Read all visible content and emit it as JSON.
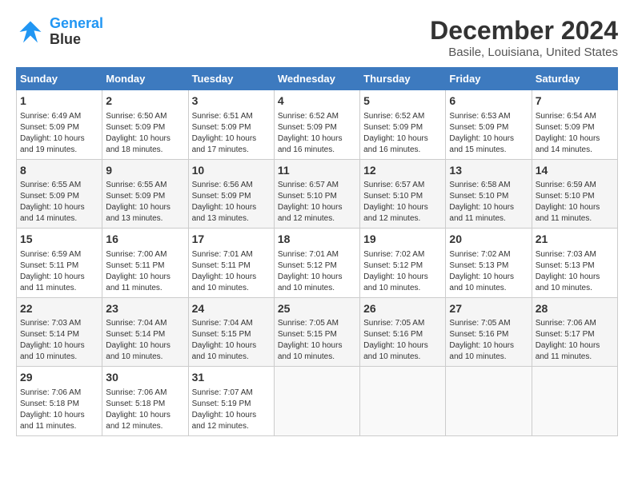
{
  "header": {
    "logo_line1": "General",
    "logo_line2": "Blue",
    "month": "December 2024",
    "location": "Basile, Louisiana, United States"
  },
  "weekdays": [
    "Sunday",
    "Monday",
    "Tuesday",
    "Wednesday",
    "Thursday",
    "Friday",
    "Saturday"
  ],
  "weeks": [
    [
      {
        "day": "1",
        "info": "Sunrise: 6:49 AM\nSunset: 5:09 PM\nDaylight: 10 hours\nand 19 minutes."
      },
      {
        "day": "2",
        "info": "Sunrise: 6:50 AM\nSunset: 5:09 PM\nDaylight: 10 hours\nand 18 minutes."
      },
      {
        "day": "3",
        "info": "Sunrise: 6:51 AM\nSunset: 5:09 PM\nDaylight: 10 hours\nand 17 minutes."
      },
      {
        "day": "4",
        "info": "Sunrise: 6:52 AM\nSunset: 5:09 PM\nDaylight: 10 hours\nand 16 minutes."
      },
      {
        "day": "5",
        "info": "Sunrise: 6:52 AM\nSunset: 5:09 PM\nDaylight: 10 hours\nand 16 minutes."
      },
      {
        "day": "6",
        "info": "Sunrise: 6:53 AM\nSunset: 5:09 PM\nDaylight: 10 hours\nand 15 minutes."
      },
      {
        "day": "7",
        "info": "Sunrise: 6:54 AM\nSunset: 5:09 PM\nDaylight: 10 hours\nand 14 minutes."
      }
    ],
    [
      {
        "day": "8",
        "info": "Sunrise: 6:55 AM\nSunset: 5:09 PM\nDaylight: 10 hours\nand 14 minutes."
      },
      {
        "day": "9",
        "info": "Sunrise: 6:55 AM\nSunset: 5:09 PM\nDaylight: 10 hours\nand 13 minutes."
      },
      {
        "day": "10",
        "info": "Sunrise: 6:56 AM\nSunset: 5:09 PM\nDaylight: 10 hours\nand 13 minutes."
      },
      {
        "day": "11",
        "info": "Sunrise: 6:57 AM\nSunset: 5:10 PM\nDaylight: 10 hours\nand 12 minutes."
      },
      {
        "day": "12",
        "info": "Sunrise: 6:57 AM\nSunset: 5:10 PM\nDaylight: 10 hours\nand 12 minutes."
      },
      {
        "day": "13",
        "info": "Sunrise: 6:58 AM\nSunset: 5:10 PM\nDaylight: 10 hours\nand 11 minutes."
      },
      {
        "day": "14",
        "info": "Sunrise: 6:59 AM\nSunset: 5:10 PM\nDaylight: 10 hours\nand 11 minutes."
      }
    ],
    [
      {
        "day": "15",
        "info": "Sunrise: 6:59 AM\nSunset: 5:11 PM\nDaylight: 10 hours\nand 11 minutes."
      },
      {
        "day": "16",
        "info": "Sunrise: 7:00 AM\nSunset: 5:11 PM\nDaylight: 10 hours\nand 11 minutes."
      },
      {
        "day": "17",
        "info": "Sunrise: 7:01 AM\nSunset: 5:11 PM\nDaylight: 10 hours\nand 10 minutes."
      },
      {
        "day": "18",
        "info": "Sunrise: 7:01 AM\nSunset: 5:12 PM\nDaylight: 10 hours\nand 10 minutes."
      },
      {
        "day": "19",
        "info": "Sunrise: 7:02 AM\nSunset: 5:12 PM\nDaylight: 10 hours\nand 10 minutes."
      },
      {
        "day": "20",
        "info": "Sunrise: 7:02 AM\nSunset: 5:13 PM\nDaylight: 10 hours\nand 10 minutes."
      },
      {
        "day": "21",
        "info": "Sunrise: 7:03 AM\nSunset: 5:13 PM\nDaylight: 10 hours\nand 10 minutes."
      }
    ],
    [
      {
        "day": "22",
        "info": "Sunrise: 7:03 AM\nSunset: 5:14 PM\nDaylight: 10 hours\nand 10 minutes."
      },
      {
        "day": "23",
        "info": "Sunrise: 7:04 AM\nSunset: 5:14 PM\nDaylight: 10 hours\nand 10 minutes."
      },
      {
        "day": "24",
        "info": "Sunrise: 7:04 AM\nSunset: 5:15 PM\nDaylight: 10 hours\nand 10 minutes."
      },
      {
        "day": "25",
        "info": "Sunrise: 7:05 AM\nSunset: 5:15 PM\nDaylight: 10 hours\nand 10 minutes."
      },
      {
        "day": "26",
        "info": "Sunrise: 7:05 AM\nSunset: 5:16 PM\nDaylight: 10 hours\nand 10 minutes."
      },
      {
        "day": "27",
        "info": "Sunrise: 7:05 AM\nSunset: 5:16 PM\nDaylight: 10 hours\nand 10 minutes."
      },
      {
        "day": "28",
        "info": "Sunrise: 7:06 AM\nSunset: 5:17 PM\nDaylight: 10 hours\nand 11 minutes."
      }
    ],
    [
      {
        "day": "29",
        "info": "Sunrise: 7:06 AM\nSunset: 5:18 PM\nDaylight: 10 hours\nand 11 minutes."
      },
      {
        "day": "30",
        "info": "Sunrise: 7:06 AM\nSunset: 5:18 PM\nDaylight: 10 hours\nand 12 minutes."
      },
      {
        "day": "31",
        "info": "Sunrise: 7:07 AM\nSunset: 5:19 PM\nDaylight: 10 hours\nand 12 minutes."
      },
      {
        "day": "",
        "info": ""
      },
      {
        "day": "",
        "info": ""
      },
      {
        "day": "",
        "info": ""
      },
      {
        "day": "",
        "info": ""
      }
    ]
  ]
}
